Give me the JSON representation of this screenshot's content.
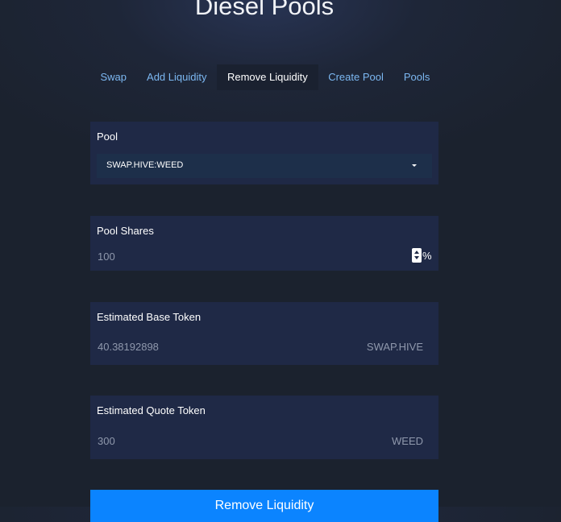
{
  "header": {
    "title": "Diesel Pools"
  },
  "tabs": [
    {
      "label": "Swap",
      "active": false
    },
    {
      "label": "Add Liquidity",
      "active": false
    },
    {
      "label": "Remove Liquidity",
      "active": true
    },
    {
      "label": "Create Pool",
      "active": false
    },
    {
      "label": "Pools",
      "active": false
    }
  ],
  "form": {
    "pool": {
      "label": "Pool",
      "selected": "SWAP.HIVE:WEED"
    },
    "pool_shares": {
      "label": "Pool Shares",
      "value": "100",
      "unit": "%"
    },
    "estimated_base": {
      "label": "Estimated Base Token",
      "value": "40.38192898",
      "token": "SWAP.HIVE"
    },
    "estimated_quote": {
      "label": "Estimated Quote Token",
      "value": "300",
      "token": "WEED"
    },
    "submit_label": "Remove Liquidity"
  },
  "colors": {
    "background": "#1b222e",
    "card": "#1f2946",
    "accent": "#0b84ff",
    "link": "#7cb8f2"
  },
  "icons": {
    "select_caret": "caret-down-icon",
    "number_spinner": "spinner-arrows-icon"
  }
}
